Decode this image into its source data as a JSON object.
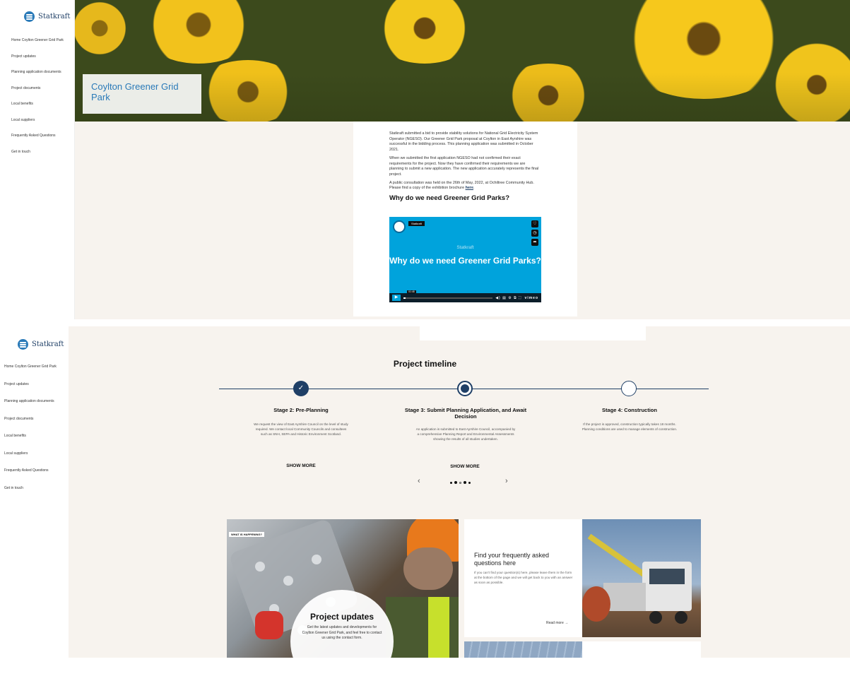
{
  "brand": {
    "name": "Statkraft",
    "accent": "#2a7ab8",
    "navy": "#1f3f66",
    "beige": "#f7f3ee"
  },
  "nav_items": [
    "Home Coylton Greener Grid Park",
    "Project updates",
    "Planning application documents",
    "Project documents",
    "Local benefits",
    "Local suppliers",
    "Frequently Asked Questions",
    "Get in touch"
  ],
  "hero": {
    "title": "Coylton Greener Grid Park"
  },
  "article": {
    "para1": "Statkraft submitted a bid to provide stability solutions for National Grid Electricity System Operator (NGESO). Our Greener Grid Park proposal at Coylton in East Ayrshire was successful in the bidding process. This planning application was submitted in October 2021.",
    "para2": "When we submitted the first application NGESO had not confirmed their exact requirements for the project. Now they have confirmed their requirements we are planning to submit a new application. The new application accurately represents the final project.",
    "para3_text": "A public consultation was held on the 26th of May, 2022, at Ochiltree Community Hub. Please find a copy of the exhibition brochure ",
    "para3_link": "here",
    "heading": "Why do we need Greener Grid Parks?"
  },
  "video": {
    "badge": "Statkraft",
    "subtitle": "Statkraft",
    "title": "Why do we need Greener Grid Parks?",
    "time": "01:48",
    "vimeo": "vimeo"
  },
  "timeline": {
    "title": "Project timeline",
    "stages": [
      {
        "title": "Stage 2: Pre-Planning",
        "desc": "We request the view of East Ayrshire Council on the level of study required. We contact local Community Councils and consultees such as SNH, SEPA and Historic Environment Scotland.",
        "show_more": "SHOW MORE",
        "state": "complete"
      },
      {
        "title": "Stage 3: Submit Planning Application, and Await Decision",
        "desc": "An application is submitted to East Ayrshire Council, accompanied by a comprehensive Planning Report and Environmental Assessments showing the results of all studies undertaken.",
        "show_more": "SHOW MORE",
        "state": "current"
      },
      {
        "title": "Stage 4: Construction",
        "desc": "If the project is approved, construction typically takes 18 months. Planning conditions are used to manage elements of construction.",
        "state": "upcoming"
      }
    ],
    "prev": "‹",
    "next": "›"
  },
  "cards": {
    "tag": "WHAT IS HAPPENING?",
    "updates_title": "Project updates",
    "updates_desc": "Get the latest updates and developments for Coylton Greener Grid Park, and feel free to contact us using the contact form.",
    "faq_title": "Find your frequently asked questions here",
    "faq_desc": "If you can't find your question(s) here, please leave them in the form at the bottom of the page and we will get back to you with an answer as soon as possible.",
    "faq_link": "Read more →"
  }
}
